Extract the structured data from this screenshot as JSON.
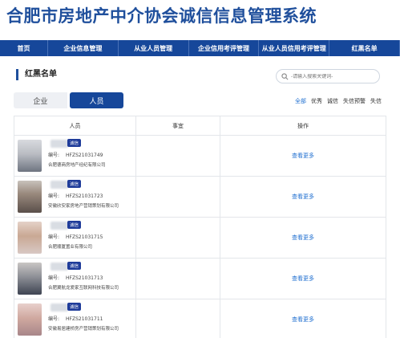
{
  "site": {
    "title": "合肥市房地产中介协会诚信信息管理系统"
  },
  "nav": {
    "items": [
      {
        "label": "首页"
      },
      {
        "label": "企业信息管理"
      },
      {
        "label": "从业人员管理"
      },
      {
        "label": "企业信用考评管理"
      },
      {
        "label": "从业人员信用考评管理"
      },
      {
        "label": "红黑名单"
      }
    ]
  },
  "section": {
    "title": "红黑名单"
  },
  "search": {
    "placeholder": "-请输入搜索关键词-"
  },
  "segments": {
    "company": "企业",
    "person": "人员"
  },
  "filters": [
    {
      "label": "全部",
      "active": true
    },
    {
      "label": "优秀",
      "active": false
    },
    {
      "label": "诚信",
      "active": false
    },
    {
      "label": "失信预警",
      "active": false
    },
    {
      "label": "失信",
      "active": false
    }
  ],
  "table": {
    "headers": {
      "person": "人员",
      "matter": "事宜",
      "action": "操作"
    },
    "number_label": "编号:",
    "rows": [
      {
        "tag": "诚信",
        "number": "HFZS21031749",
        "company": "合肥德商房地产经纪有限公司",
        "action": "查看更多",
        "photo": "#b9bcc2"
      },
      {
        "tag": "诚信",
        "number": "HFZS21031723",
        "company": "安徽欣安家房地产营销策划有限公司",
        "action": "查看更多",
        "photo": "#9a8a7e"
      },
      {
        "tag": "诚信",
        "number": "HFZS21031715",
        "company": "合肥顺厦置业有限公司",
        "action": "查看更多",
        "photo": "#c9a894"
      },
      {
        "tag": "诚信",
        "number": "HFZS21031713",
        "company": "合肥翼航龙爱家互联网科技有限公司",
        "action": "查看更多",
        "photo": "#8d8f96"
      },
      {
        "tag": "诚信",
        "number": "HFZS21031711",
        "company": "安徽易居建桥房产营销策划有限公司",
        "action": "查看更多",
        "photo": "#d0a9a0"
      }
    ]
  }
}
